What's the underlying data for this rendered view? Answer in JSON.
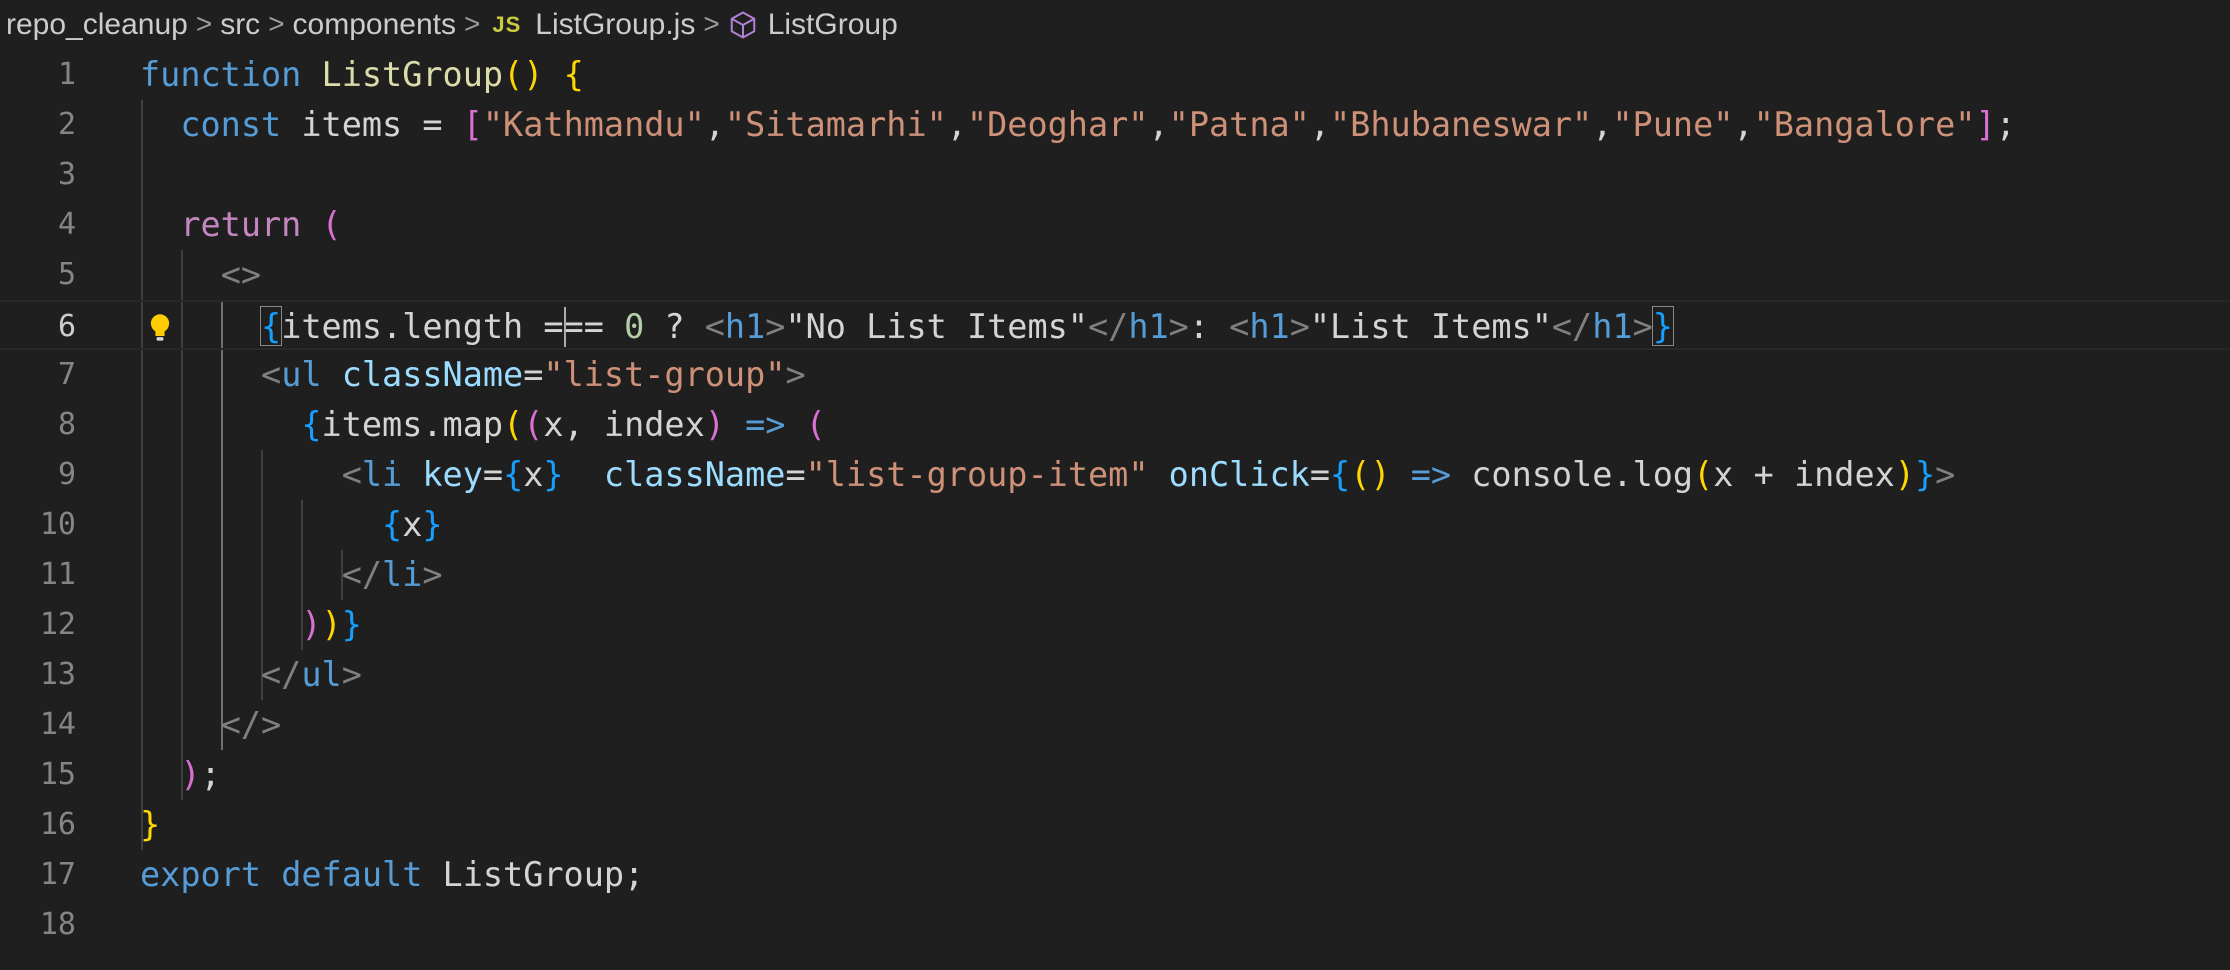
{
  "breadcrumb": {
    "items": [
      "repo_cleanup",
      "src",
      "components",
      "ListGroup.js",
      "ListGroup"
    ],
    "separator": ">",
    "file_badge": "JS"
  },
  "editor": {
    "line_numbers": [
      "1",
      "2",
      "3",
      "4",
      "5",
      "6",
      "7",
      "8",
      "9",
      "10",
      "11",
      "12",
      "13",
      "14",
      "15",
      "16",
      "17",
      "18"
    ],
    "active_line": "6",
    "lines": [
      [
        [
          "kw",
          "function"
        ],
        [
          "plain",
          " "
        ],
        [
          "fn",
          "ListGroup"
        ],
        [
          "p1",
          "()"
        ],
        [
          "plain",
          " "
        ],
        [
          "p1",
          "{"
        ]
      ],
      [
        [
          "plain",
          "  "
        ],
        [
          "kw",
          "const"
        ],
        [
          "plain",
          " items = "
        ],
        [
          "p2",
          "["
        ],
        [
          "str",
          "\"Kathmandu\""
        ],
        [
          "plain",
          ","
        ],
        [
          "str",
          "\"Sitamarhi\""
        ],
        [
          "plain",
          ","
        ],
        [
          "str",
          "\"Deoghar\""
        ],
        [
          "plain",
          ","
        ],
        [
          "str",
          "\"Patna\""
        ],
        [
          "plain",
          ","
        ],
        [
          "str",
          "\"Bhubaneswar\""
        ],
        [
          "plain",
          ","
        ],
        [
          "str",
          "\"Pune\""
        ],
        [
          "plain",
          ","
        ],
        [
          "str",
          "\"Bangalore\""
        ],
        [
          "p2",
          "]"
        ],
        [
          "plain",
          ";"
        ]
      ],
      [],
      [
        [
          "plain",
          "  "
        ],
        [
          "kw2",
          "return"
        ],
        [
          "plain",
          " "
        ],
        [
          "p2",
          "("
        ]
      ],
      [
        [
          "plain",
          "    "
        ],
        [
          "ang",
          "<>"
        ]
      ],
      [
        [
          "plain",
          "      "
        ],
        [
          "p3",
          "{"
        ],
        [
          "plain",
          "items.length === "
        ],
        [
          "num",
          "0"
        ],
        [
          "plain",
          " ? "
        ],
        [
          "ang",
          "<"
        ],
        [
          "tag",
          "h1"
        ],
        [
          "ang",
          ">"
        ],
        [
          "plain",
          "\"No List Items\""
        ],
        [
          "ang",
          "</"
        ],
        [
          "tag",
          "h1"
        ],
        [
          "ang",
          ">"
        ],
        [
          "plain",
          ": "
        ],
        [
          "ang",
          "<"
        ],
        [
          "tag",
          "h1"
        ],
        [
          "ang",
          ">"
        ],
        [
          "plain",
          "\"List Items\""
        ],
        [
          "ang",
          "</"
        ],
        [
          "tag",
          "h1"
        ],
        [
          "ang",
          ">"
        ],
        [
          "p3",
          "}"
        ]
      ],
      [
        [
          "plain",
          "      "
        ],
        [
          "ang",
          "<"
        ],
        [
          "tag",
          "ul"
        ],
        [
          "plain",
          " "
        ],
        [
          "attr",
          "className"
        ],
        [
          "plain",
          "="
        ],
        [
          "str",
          "\"list-group\""
        ],
        [
          "ang",
          ">"
        ]
      ],
      [
        [
          "plain",
          "        "
        ],
        [
          "p3",
          "{"
        ],
        [
          "plain",
          "items.map"
        ],
        [
          "p1",
          "("
        ],
        [
          "p2",
          "("
        ],
        [
          "plain",
          "x, index"
        ],
        [
          "p2",
          ")"
        ],
        [
          "plain",
          " "
        ],
        [
          "kw",
          "=>"
        ],
        [
          "plain",
          " "
        ],
        [
          "p2",
          "("
        ]
      ],
      [
        [
          "plain",
          "          "
        ],
        [
          "ang",
          "<"
        ],
        [
          "tag",
          "li"
        ],
        [
          "plain",
          " "
        ],
        [
          "attr",
          "key"
        ],
        [
          "plain",
          "="
        ],
        [
          "p3",
          "{"
        ],
        [
          "plain",
          "x"
        ],
        [
          "p3",
          "}"
        ],
        [
          "plain",
          "  "
        ],
        [
          "attr",
          "className"
        ],
        [
          "plain",
          "="
        ],
        [
          "str",
          "\"list-group-item\""
        ],
        [
          "plain",
          " "
        ],
        [
          "attr",
          "onClick"
        ],
        [
          "plain",
          "="
        ],
        [
          "p3",
          "{"
        ],
        [
          "p1",
          "()"
        ],
        [
          "plain",
          " "
        ],
        [
          "kw",
          "=>"
        ],
        [
          "plain",
          " console.log"
        ],
        [
          "p1",
          "("
        ],
        [
          "plain",
          "x + index"
        ],
        [
          "p1",
          ")"
        ],
        [
          "p3",
          "}"
        ],
        [
          "ang",
          ">"
        ]
      ],
      [
        [
          "plain",
          "            "
        ],
        [
          "p3",
          "{"
        ],
        [
          "plain",
          "x"
        ],
        [
          "p3",
          "}"
        ]
      ],
      [
        [
          "plain",
          "          "
        ],
        [
          "ang",
          "</"
        ],
        [
          "tag",
          "li"
        ],
        [
          "ang",
          ">"
        ]
      ],
      [
        [
          "plain",
          "        "
        ],
        [
          "p2",
          ")"
        ],
        [
          "p1",
          ")"
        ],
        [
          "p3",
          "}"
        ]
      ],
      [
        [
          "plain",
          "      "
        ],
        [
          "ang",
          "</"
        ],
        [
          "tag",
          "ul"
        ],
        [
          "ang",
          ">"
        ]
      ],
      [
        [
          "plain",
          "    "
        ],
        [
          "ang",
          "</>"
        ]
      ],
      [
        [
          "plain",
          "  "
        ],
        [
          "p2",
          ")"
        ],
        [
          "plain",
          ";"
        ]
      ],
      [
        [
          "p1",
          "}"
        ]
      ],
      [
        [
          "kw",
          "export"
        ],
        [
          "plain",
          " "
        ],
        [
          "kw",
          "default"
        ],
        [
          "plain",
          " ListGroup;"
        ]
      ],
      []
    ]
  },
  "colors": {
    "background": "#1f1f1f",
    "keyword": "#569cd6",
    "control_keyword": "#c586c0",
    "function": "#dcdcaa",
    "string": "#ce9178",
    "number": "#b5cea8",
    "bracket_gold": "#ffd700",
    "bracket_orchid": "#da70d6",
    "bracket_blue": "#179fff"
  },
  "icons": {
    "lightbulb": "lightbulb-icon",
    "symbol": "symbol-method-icon"
  }
}
